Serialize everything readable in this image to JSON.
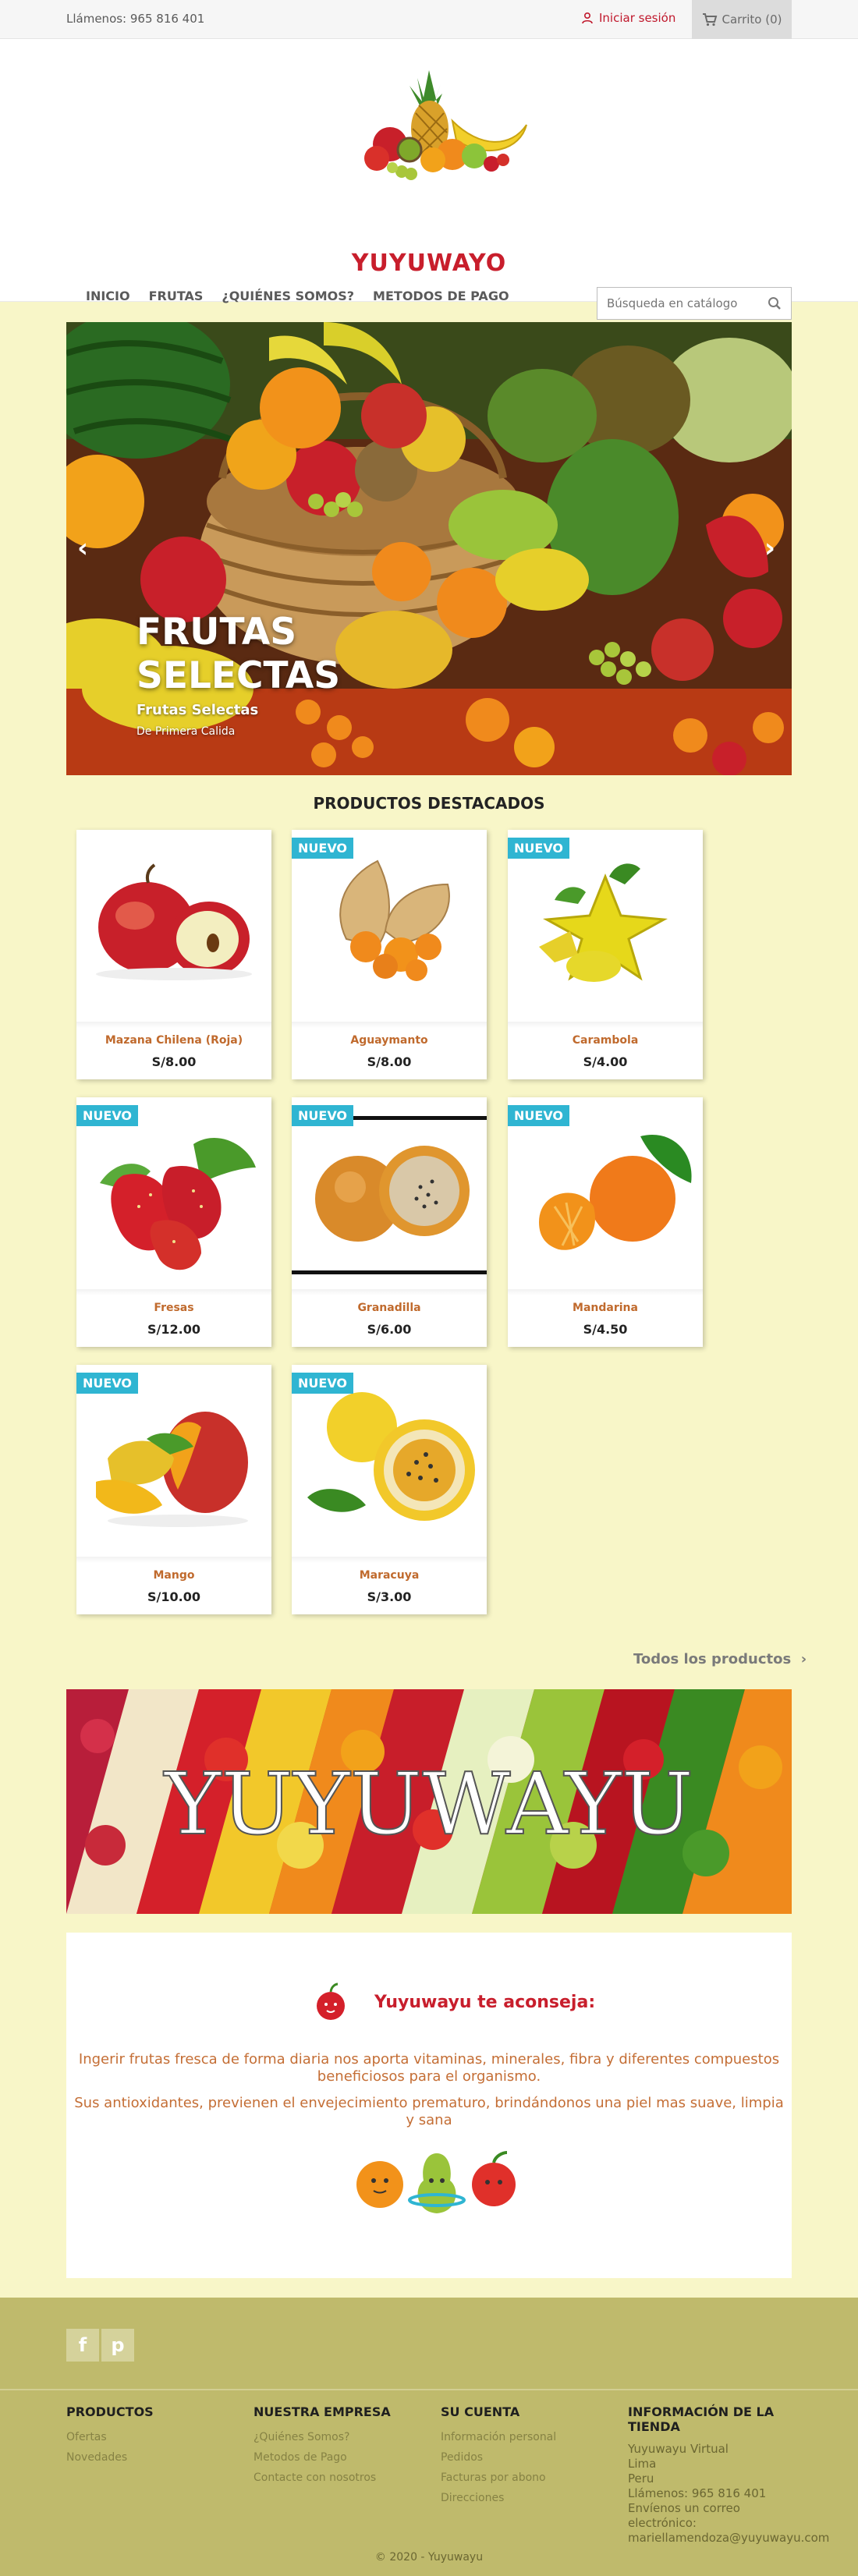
{
  "topbar": {
    "phone": "Llámenos: 965 816 401",
    "login": "Iniciar sesión",
    "cart": "Carrito (0)"
  },
  "header": {
    "brand": "YUYUWAYO",
    "menu": [
      "INICIO",
      "FRUTAS",
      "¿QUIÉNES SOMOS?",
      "METODOS DE PAGO"
    ],
    "search_placeholder": "Búsqueda en catálogo"
  },
  "slider": {
    "title_line1": "FRUTAS",
    "title_line2": "SELECTAS",
    "subtitle": "Frutas Selectas",
    "caption": "De Primera Calida"
  },
  "featured": {
    "title": "PRODUCTOS DESTACADOS",
    "badge": "NUEVO",
    "products": [
      {
        "name": "Mazana Chilena (Roja)",
        "price": "S/8.00"
      },
      {
        "name": "Aguaymanto",
        "price": "S/8.00"
      },
      {
        "name": "Carambola",
        "price": "S/4.00"
      },
      {
        "name": "Fresas",
        "price": "S/12.00"
      },
      {
        "name": "Granadilla",
        "price": "S/6.00"
      },
      {
        "name": "Mandarina",
        "price": "S/4.50"
      },
      {
        "name": "Mango",
        "price": "S/10.00"
      },
      {
        "name": "Maracuya",
        "price": "S/3.00"
      }
    ],
    "all_products": "Todos los productos"
  },
  "banner": {
    "text": "YUYUWAYU"
  },
  "advice": {
    "title": "Yuyuwayu te aconseja:",
    "p1_line1": "Ingerir frutas fresca de forma diaria nos aporta vitaminas, minerales, fibra y diferentes compuestos",
    "p1_line2": "beneficiosos para el organismo.",
    "p2_line1": "Sus antioxidantes, previenen el envejecimiento prematuro, brindándonos una piel mas suave, limpia",
    "p2_line2": "y sana"
  },
  "footer": {
    "col1": {
      "title": "PRODUCTOS",
      "links": [
        "Ofertas",
        "Novedades"
      ]
    },
    "col2": {
      "title": "NUESTRA EMPRESA",
      "links": [
        "¿Quiénes Somos?",
        "Metodos de Pago",
        "Contacte con nosotros"
      ]
    },
    "col3": {
      "title": "SU CUENTA",
      "links": [
        "Información personal",
        "Pedidos",
        "Facturas por abono",
        "Direcciones"
      ]
    },
    "col4": {
      "title_line1": "INFORMACIÓN DE LA",
      "title_line2": "TIENDA",
      "lines": [
        "Yuyuwayu Virtual",
        "Lima",
        "Peru",
        "Llámenos: 965 816 401",
        "Envíenos un correo",
        "electrónico:",
        "mariellamendoza@yuyuwayu.com"
      ]
    },
    "copyright": "© 2020 - Yuyuwayu"
  },
  "colors": {
    "accent": "#c81e2c",
    "badge": "#2fb5d2",
    "page_bg": "#f8f6c8",
    "footer_bg": "#bfba6c"
  }
}
